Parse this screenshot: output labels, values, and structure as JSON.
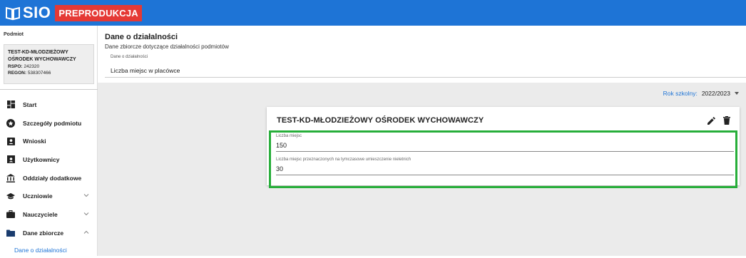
{
  "app": {
    "logo_text": "SIO",
    "env_badge": "PREPRODUKCJA",
    "brand_color": "#1e74d6",
    "env_color": "#e53935"
  },
  "sidebar": {
    "podmiot_label": "Podmiot",
    "podmiot": {
      "name": "TEST-KD-MŁODZIEŻOWY OŚRODEK WYCHOWAWCZY",
      "rspo_label": "RSPO:",
      "rspo": "242320",
      "regon_label": "REGON:",
      "regon": "538307466"
    },
    "items": [
      {
        "label": "Start",
        "icon": "dashboard-icon"
      },
      {
        "label": "Szczegóły podmiotu",
        "icon": "info-star-icon"
      },
      {
        "label": "Wnioski",
        "icon": "account-box-icon"
      },
      {
        "label": "Użytkownicy",
        "icon": "contact-card-icon"
      },
      {
        "label": "Oddziały dodatkowe",
        "icon": "bank-icon"
      },
      {
        "label": "Uczniowie",
        "icon": "school-icon",
        "expand": "down"
      },
      {
        "label": "Nauczyciele",
        "icon": "briefcase-icon",
        "expand": "down"
      },
      {
        "label": "Dane zbiorcze",
        "icon": "folder-icon",
        "expand": "up"
      }
    ],
    "sub_item": "Dane o działalności"
  },
  "main": {
    "title": "Dane o działalności",
    "subtitle": "Dane zbiorcze dotyczące działalności podmiotów",
    "select": {
      "legend": "Dane o działalności",
      "value": "Liczba miejsc w placówce"
    },
    "year": {
      "label": "Rok szkolny:",
      "value": "2022/2023"
    },
    "card": {
      "title": "TEST-KD-MŁODZIEŻOWY OŚRODEK WYCHOWAWCZY",
      "fields": [
        {
          "label": "Liczba miejsc",
          "value": "150"
        },
        {
          "label": "Liczba miejsc przeznaczonych na tymczasowe umieszczenie nieletnich",
          "value": "30"
        }
      ],
      "highlight_color": "#27ae3a"
    }
  }
}
